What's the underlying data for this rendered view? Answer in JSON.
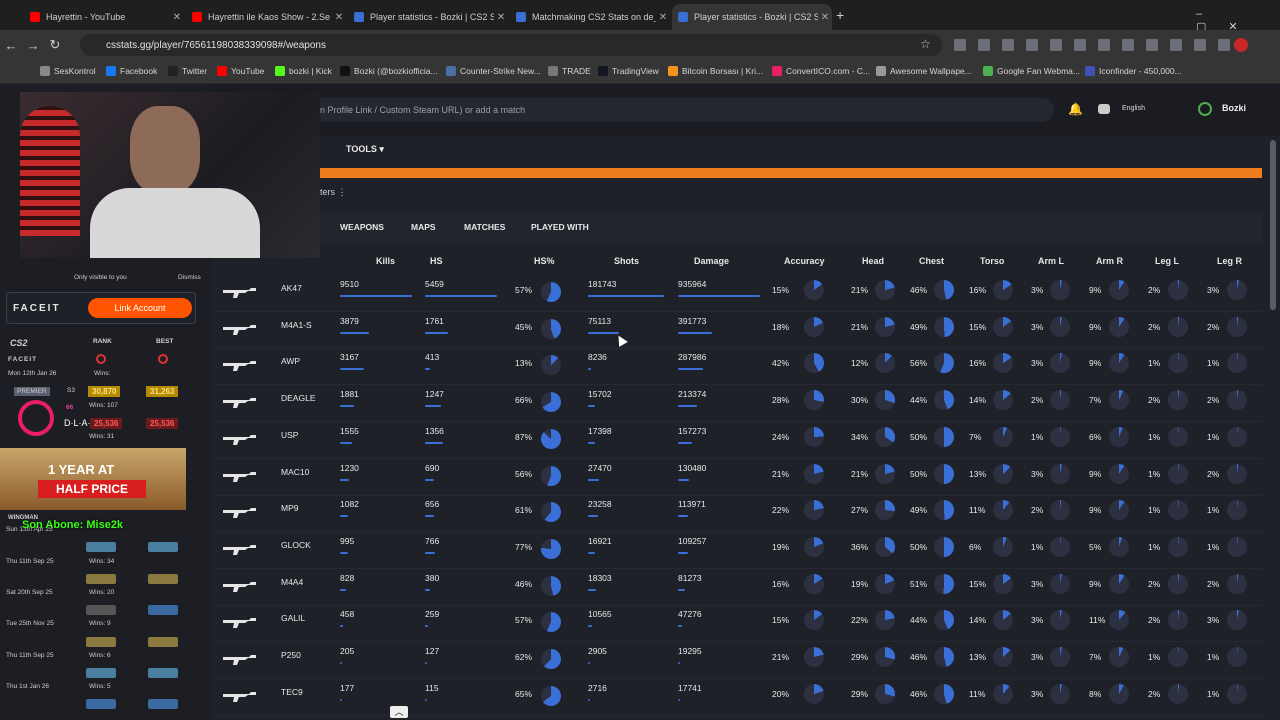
{
  "browser": {
    "tabs": [
      {
        "title": "Hayrettin - YouTube",
        "favicon_color": "#ff0000"
      },
      {
        "title": "Hayrettin ile Kaos Show - 2.Se",
        "favicon_color": "#ff0000"
      },
      {
        "title": "Player statistics - Bozki | CS2 St",
        "favicon_color": "#3b6fd8"
      },
      {
        "title": "Matchmaking CS2 Stats on de_",
        "favicon_color": "#3b6fd8"
      },
      {
        "title": "Player statistics - Bozki | CS2 St",
        "favicon_color": "#3b6fd8"
      }
    ],
    "url": "csstats.gg/player/76561198038339098#/weapons",
    "bookmarks": [
      "SesKontrol",
      "Facebook",
      "Twitter",
      "YouTube",
      "bozki | Kick",
      "Bozki (@bozkiofficia...",
      "Counter-Strike New...",
      "TRADE",
      "TradingView",
      "Bitcoin Borsası | Kri...",
      "ConvertICO.com - C...",
      "Awesome Wallpape...",
      "Google Fan Webma...",
      "Iconfinder - 450,000..."
    ]
  },
  "site": {
    "search_placeholder": "n Profile Link / Custom Steam URL) or add a match",
    "language": "English",
    "username": "Bozki",
    "tools_label": "TOOLS",
    "filters_label": "ters",
    "subtabs": [
      "WEAPONS",
      "MAPS",
      "MATCHES",
      "PLAYED WITH"
    ]
  },
  "table": {
    "headers": [
      "Kills",
      "HS",
      "HS%",
      "Shots",
      "Damage",
      "Accuracy",
      "Head",
      "Chest",
      "Torso",
      "Arm L",
      "Arm R",
      "Leg L",
      "Leg R"
    ],
    "rows": [
      {
        "name": "AK47",
        "kills": "9510",
        "hs": "5459",
        "hsp": "57%",
        "shots": "181743",
        "damage": "935964",
        "acc": "15%",
        "head": "21%",
        "chest": "46%",
        "torso": "16%",
        "arml": "3%",
        "armr": "9%",
        "legl": "2%",
        "legr": "3%"
      },
      {
        "name": "M4A1-S",
        "kills": "3879",
        "hs": "1761",
        "hsp": "45%",
        "shots": "75113",
        "damage": "391773",
        "acc": "18%",
        "head": "21%",
        "chest": "49%",
        "torso": "15%",
        "arml": "3%",
        "armr": "9%",
        "legl": "2%",
        "legr": "2%"
      },
      {
        "name": "AWP",
        "kills": "3167",
        "hs": "413",
        "hsp": "13%",
        "shots": "8236",
        "damage": "287986",
        "acc": "42%",
        "head": "12%",
        "chest": "56%",
        "torso": "16%",
        "arml": "3%",
        "armr": "9%",
        "legl": "1%",
        "legr": "1%"
      },
      {
        "name": "DEAGLE",
        "kills": "1881",
        "hs": "1247",
        "hsp": "66%",
        "shots": "15702",
        "damage": "213374",
        "acc": "28%",
        "head": "30%",
        "chest": "44%",
        "torso": "14%",
        "arml": "2%",
        "armr": "7%",
        "legl": "2%",
        "legr": "2%"
      },
      {
        "name": "USP",
        "kills": "1555",
        "hs": "1356",
        "hsp": "87%",
        "shots": "17398",
        "damage": "157273",
        "acc": "24%",
        "head": "34%",
        "chest": "50%",
        "torso": "7%",
        "arml": "1%",
        "armr": "6%",
        "legl": "1%",
        "legr": "1%"
      },
      {
        "name": "MAC10",
        "kills": "1230",
        "hs": "690",
        "hsp": "56%",
        "shots": "27470",
        "damage": "130480",
        "acc": "21%",
        "head": "21%",
        "chest": "50%",
        "torso": "13%",
        "arml": "3%",
        "armr": "9%",
        "legl": "1%",
        "legr": "2%"
      },
      {
        "name": "MP9",
        "kills": "1082",
        "hs": "656",
        "hsp": "61%",
        "shots": "23258",
        "damage": "113971",
        "acc": "22%",
        "head": "27%",
        "chest": "49%",
        "torso": "11%",
        "arml": "2%",
        "armr": "9%",
        "legl": "1%",
        "legr": "1%"
      },
      {
        "name": "GLOCK",
        "kills": "995",
        "hs": "766",
        "hsp": "77%",
        "shots": "16921",
        "damage": "109257",
        "acc": "19%",
        "head": "36%",
        "chest": "50%",
        "torso": "6%",
        "arml": "1%",
        "armr": "5%",
        "legl": "1%",
        "legr": "1%"
      },
      {
        "name": "M4A4",
        "kills": "828",
        "hs": "380",
        "hsp": "46%",
        "shots": "18303",
        "damage": "81273",
        "acc": "16%",
        "head": "19%",
        "chest": "51%",
        "torso": "15%",
        "arml": "3%",
        "armr": "9%",
        "legl": "2%",
        "legr": "2%"
      },
      {
        "name": "GALIL",
        "kills": "458",
        "hs": "259",
        "hsp": "57%",
        "shots": "10565",
        "damage": "47276",
        "acc": "15%",
        "head": "22%",
        "chest": "44%",
        "torso": "14%",
        "arml": "3%",
        "armr": "11%",
        "legl": "2%",
        "legr": "3%"
      },
      {
        "name": "P250",
        "kills": "205",
        "hs": "127",
        "hsp": "62%",
        "shots": "2905",
        "damage": "19295",
        "acc": "21%",
        "head": "29%",
        "chest": "46%",
        "torso": "13%",
        "arml": "3%",
        "armr": "7%",
        "legl": "1%",
        "legr": "1%"
      },
      {
        "name": "TEC9",
        "kills": "177",
        "hs": "115",
        "hsp": "65%",
        "shots": "2716",
        "damage": "17741",
        "acc": "20%",
        "head": "29%",
        "chest": "46%",
        "torso": "11%",
        "arml": "3%",
        "armr": "8%",
        "legl": "2%",
        "legr": "1%"
      }
    ]
  },
  "left": {
    "only_visible": "Only visible to you",
    "dismiss": "Dismiss",
    "faceit": "FACEIT",
    "link_account": "Link Account",
    "cs2": "CS2",
    "rank": "RANK",
    "best": "BEST",
    "premier": "PREMIER",
    "wins_label": "Wins:",
    "rating_now": "30,870",
    "rating_best": "31,263",
    "rating2_now": "25,536",
    "rating2_best": "25,536",
    "wins1": "Wins: 107",
    "wins2": "Wins: 31",
    "promo_line1": "1 YEAR AT",
    "promo_line2": "HALF PRICE",
    "overlay": "Son Abone: Mise2k",
    "wingman": "WINGMAN",
    "dates": [
      "Mon 12th Jan 26",
      "Sun 13th Apr 25",
      "Thu 11th Sep 25",
      "Sat 20th Sep 25",
      "Tue 25th Nov 25",
      "Thu 11th Sep 25",
      "Thu 1st Jan 26"
    ],
    "wins_list": [
      "Wins: 34",
      "Wins: 20",
      "Wins: 9",
      "Wins: 6",
      "Wins: 5"
    ],
    "lan": "D·L·A·N",
    "s3": "S3",
    "num66": "66"
  }
}
